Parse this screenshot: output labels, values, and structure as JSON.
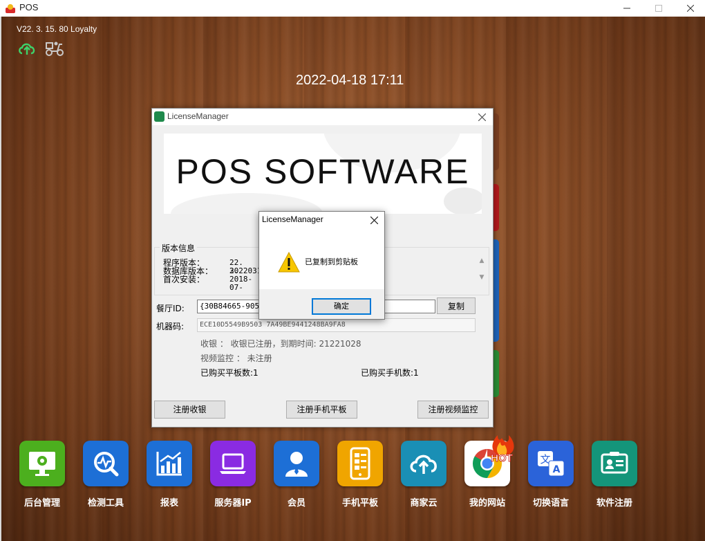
{
  "window": {
    "title": "POS"
  },
  "header": {
    "version": "V22. 3. 15. 80 Loyalty",
    "datetime": "2022-04-18 17:11"
  },
  "license_window": {
    "title": "LicenseManager",
    "banner_text": "POS SOFTWARE",
    "version_group": {
      "label": "版本信息",
      "rows": [
        {
          "label": "程序版本：",
          "value": "22. 3."
        },
        {
          "label": "数据库版本：",
          "value": "2022031"
        },
        {
          "label": "首次安装：",
          "value": "2018-07-"
        }
      ]
    },
    "restaurant_id": {
      "label": "餐厅ID:",
      "value": "{30B84665-905F-"
    },
    "copy_button": "复制",
    "machine_code": {
      "label": "机器码:",
      "value": "ECE10D5549B9503                                    7A49BE9441248BA9FA8"
    },
    "status_pos": "收银 ： 收银已注册，到期时间: 21221028",
    "status_video": "视频监控 ： 未注册",
    "bought_tablets": "已购买平板数:1",
    "bought_phones": "已购买手机数:1",
    "buttons": {
      "register_pos": "注册收银",
      "register_tablet": "注册手机平板",
      "register_video": "注册视频监控"
    }
  },
  "message_box": {
    "title": "LicenseManager",
    "message": "已复制到剪贴板",
    "ok": "确定"
  },
  "dock": {
    "hot_label": "HOT",
    "items": [
      {
        "label": "后台管理",
        "icon": "monitor-gear-icon",
        "color": "#4caf1e"
      },
      {
        "label": "检测工具",
        "icon": "magnifier-pulse-icon",
        "color": "#1d6fd6"
      },
      {
        "label": "报表",
        "icon": "bar-chart-icon",
        "color": "#1d6fd6"
      },
      {
        "label": "服务器IP",
        "icon": "laptop-icon",
        "color": "#8a2be2"
      },
      {
        "label": "会员",
        "icon": "person-icon",
        "color": "#1d6fd6"
      },
      {
        "label": "手机平板",
        "icon": "tablet-icon",
        "color": "#f0a500"
      },
      {
        "label": "商家云",
        "icon": "cloud-upload-icon",
        "color": "#1a8fb5"
      },
      {
        "label": "我的网站",
        "icon": "chrome-icon",
        "color": "#ffffff"
      },
      {
        "label": "切换语言",
        "icon": "translate-icon",
        "color": "#2b63d9"
      },
      {
        "label": "软件注册",
        "icon": "id-card-icon",
        "color": "#14957a"
      }
    ]
  }
}
